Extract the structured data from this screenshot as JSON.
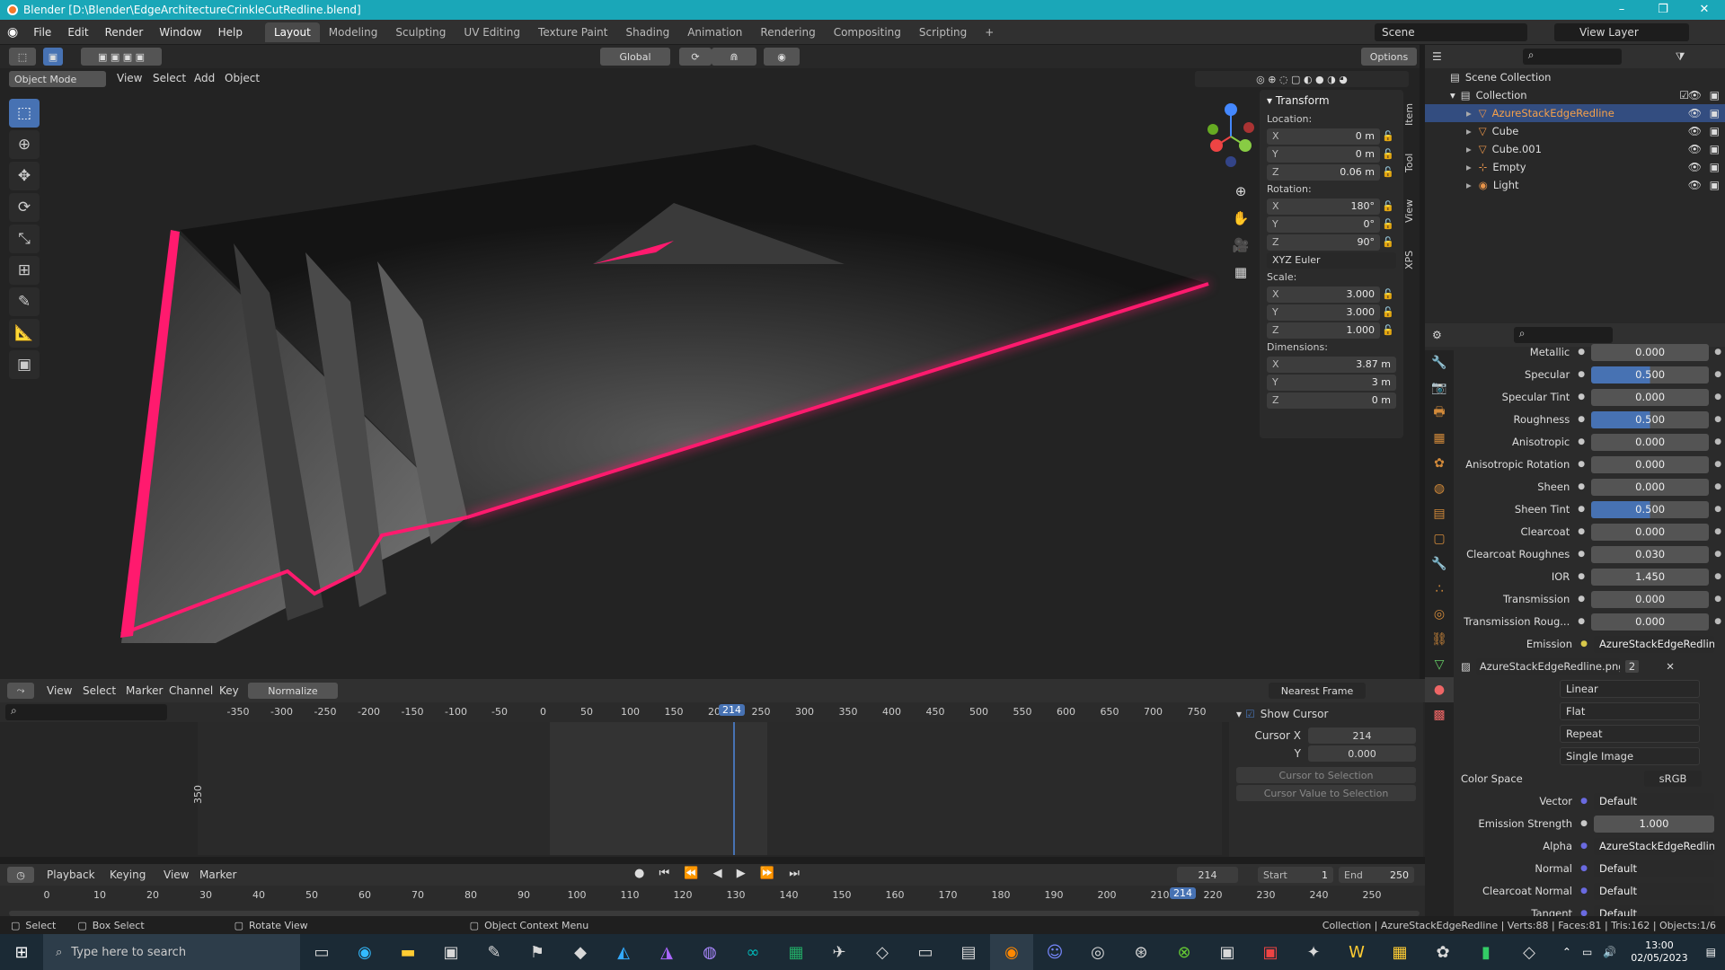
{
  "title": "Blender [D:\\Blender\\EdgeArchitectureCrinkleCutRedline.blend]",
  "menu": [
    "File",
    "Edit",
    "Render",
    "Window",
    "Help"
  ],
  "workspaces": [
    "Layout",
    "Modeling",
    "Sculpting",
    "UV Editing",
    "Texture Paint",
    "Shading",
    "Animation",
    "Rendering",
    "Compositing",
    "Scripting"
  ],
  "scene": {
    "label": "Scene",
    "view_layer": "View Layer"
  },
  "toolbar": {
    "orientation": "Global",
    "options": "Options"
  },
  "viewport_header": {
    "mode": "Object Mode",
    "view": "View",
    "select": "Select",
    "add": "Add",
    "object": "Object"
  },
  "transform": {
    "title": "Transform",
    "location_label": "Location:",
    "location": [
      [
        "X",
        "0 m"
      ],
      [
        "Y",
        "0 m"
      ],
      [
        "Z",
        "0.06 m"
      ]
    ],
    "rotation_label": "Rotation:",
    "rotation": [
      [
        "X",
        "180°"
      ],
      [
        "Y",
        "0°"
      ],
      [
        "Z",
        "90°"
      ]
    ],
    "rotation_mode": "XYZ Euler",
    "scale_label": "Scale:",
    "scale": [
      [
        "X",
        "3.000"
      ],
      [
        "Y",
        "3.000"
      ],
      [
        "Z",
        "1.000"
      ]
    ],
    "dimensions_label": "Dimensions:",
    "dimensions": [
      [
        "X",
        "3.87 m"
      ],
      [
        "Y",
        "3 m"
      ],
      [
        "Z",
        "0 m"
      ]
    ]
  },
  "side_tabs": [
    "Item",
    "Tool",
    "View",
    "XPS"
  ],
  "outliner": {
    "root": "Scene Collection",
    "collection": "Collection",
    "items": [
      "AzureStackEdgeRedline",
      "Cube",
      "Cube.001",
      "Empty",
      "Light"
    ]
  },
  "properties": {
    "rows": [
      [
        "Metallic",
        "0.000"
      ],
      [
        "Specular",
        "0.500"
      ],
      [
        "Specular Tint",
        "0.000"
      ],
      [
        "Roughness",
        "0.500"
      ],
      [
        "Anisotropic",
        "0.000"
      ],
      [
        "Anisotropic Rotation",
        "0.000"
      ],
      [
        "Sheen",
        "0.000"
      ],
      [
        "Sheen Tint",
        "0.500"
      ],
      [
        "Clearcoat",
        "0.000"
      ],
      [
        "Clearcoat Roughnes",
        "0.030"
      ],
      [
        "IOR",
        "1.450"
      ],
      [
        "Transmission",
        "0.000"
      ],
      [
        "Transmission Roug...",
        "0.000"
      ]
    ],
    "emission_label": "Emission",
    "emission_value": "AzureStackEdgeRedline.p...",
    "image_name": "AzureStackEdgeRedline.png",
    "image_users": "2",
    "interp": "Linear",
    "projection": "Flat",
    "extension": "Repeat",
    "source": "Single Image",
    "color_space_label": "Color Space",
    "color_space": "sRGB",
    "vector_label": "Vector",
    "vector": "Default",
    "emission_strength_label": "Emission Strength",
    "emission_strength": "1.000",
    "alpha_label": "Alpha",
    "alpha": "AzureStackEdgeRedline.p...",
    "normal_label": "Normal",
    "normal": "Default",
    "clearcoat_normal_label": "Clearcoat Normal",
    "clearcoat_normal": "Default",
    "tangent_label": "Tangent",
    "tangent": "Default"
  },
  "graph": {
    "menus": [
      "View",
      "Select",
      "Marker",
      "Channel",
      "Key"
    ],
    "normalize": "Normalize",
    "snap": "Nearest Frame",
    "ticks": [
      "-350",
      "-300",
      "-250",
      "-200",
      "-150",
      "-100",
      "-50",
      "0",
      "50",
      "100",
      "150",
      "200",
      "250",
      "300",
      "350",
      "400",
      "450",
      "500",
      "550",
      "600",
      "650",
      "700",
      "750"
    ],
    "current": "214",
    "y_tick": "350",
    "show_cursor": "Show Cursor",
    "cursor_x_label": "Cursor X",
    "cursor_x": "214",
    "cursor_y_label": "Y",
    "cursor_y": "0.000",
    "cursor_to_sel": "Cursor to Selection",
    "cursor_val_to_sel": "Cursor Value to Selection"
  },
  "timeline": {
    "menus": [
      "Playback",
      "Keying",
      "View",
      "Marker"
    ],
    "frame": "214",
    "start_label": "Start",
    "start": "1",
    "end_label": "End",
    "end": "250",
    "ticks": [
      "0",
      "10",
      "20",
      "30",
      "40",
      "50",
      "60",
      "70",
      "80",
      "90",
      "100",
      "110",
      "120",
      "130",
      "140",
      "150",
      "160",
      "170",
      "180",
      "190",
      "200",
      "210",
      "220",
      "230",
      "240",
      "250"
    ]
  },
  "status": {
    "select": "Select",
    "box_select": "Box Select",
    "rotate_view": "Rotate View",
    "context_menu": "Object Context Menu",
    "stats": "Collection | AzureStackEdgeRedline | Verts:88 | Faces:81 | Tris:162 | Objects:1/6"
  },
  "taskbar": {
    "search": "Type here to search",
    "time": "13:00",
    "date": "02/05/2023"
  },
  "colors": {
    "accent": "#4772b3",
    "neon": "#ff1a6e",
    "titlebar": "#1aa7b8"
  }
}
